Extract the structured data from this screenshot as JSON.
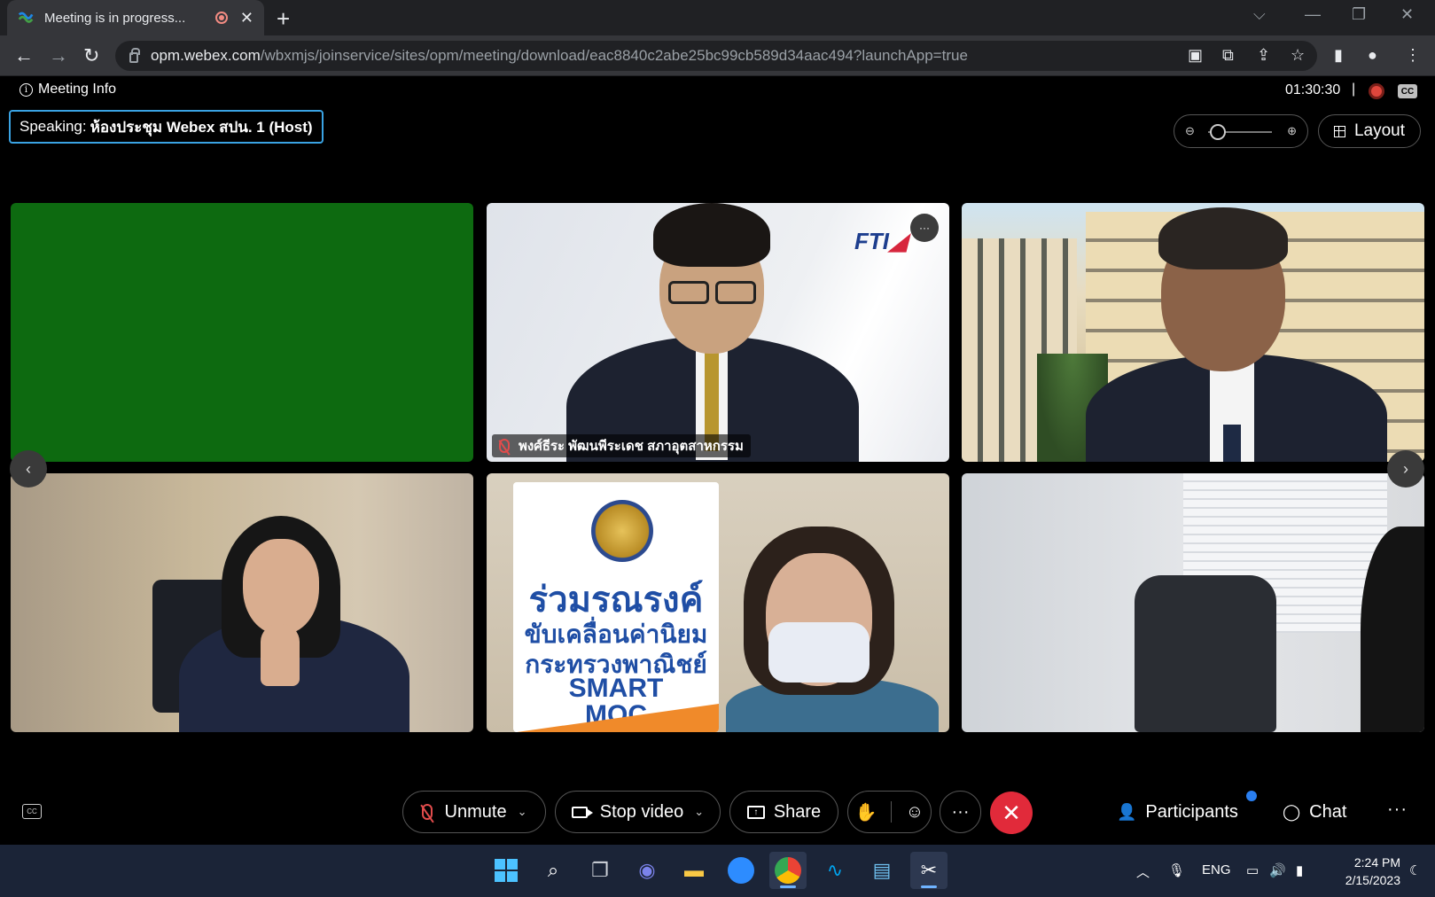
{
  "browser": {
    "tab_title": "Meeting is in progress...",
    "url_host": "opm.webex.com",
    "url_path": "/wbxmjs/joinservice/sites/opm/meeting/download/eac8840c2abe25bc99cb589d34aac494?launchApp=true"
  },
  "meeting": {
    "info_label": "Meeting Info",
    "elapsed": "01:30:30",
    "separator": "|",
    "speaking_prefix": "Speaking:",
    "speaking_name": "ห้องประชุม Webex สปน. 1 (Host)",
    "layout_label": "Layout",
    "cc_label": "CC"
  },
  "tiles": {
    "fti_logo": "FTI",
    "participant_name": "พงศ์ธีระ พัฒนพีระเดช สภาอุตสาหกรรม",
    "banner_line1": "ร่วมรณรงค์",
    "banner_line2": "ขับเคลื่อนค่านิยม",
    "banner_line3": "กระทรวงพาณิชย์",
    "banner_line4": "SMART",
    "banner_line5": "MOC"
  },
  "controls": {
    "unmute": "Unmute",
    "stop_video": "Stop video",
    "share": "Share",
    "participants": "Participants",
    "chat": "Chat"
  },
  "taskbar": {
    "language": "ENG",
    "time": "2:24 PM",
    "date": "2/15/2023"
  },
  "colors": {
    "accent_blue": "#3aa3e3",
    "end_call_red": "#e12a3a",
    "muted_red": "#e14c4c",
    "notification_blue": "#2a7ff0"
  }
}
